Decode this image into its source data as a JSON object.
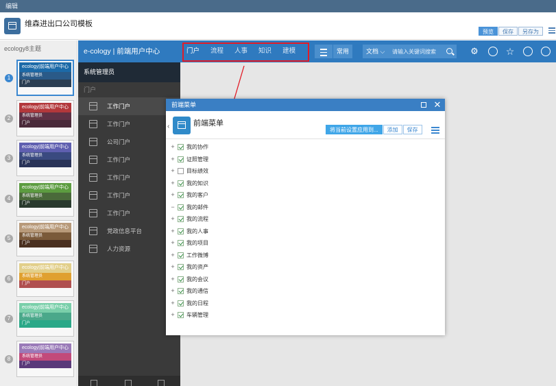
{
  "window": {
    "title": "编辑"
  },
  "header": {
    "title": "维森进出口公司模板",
    "actions": [
      "预览",
      "保存",
      "另存为"
    ],
    "list_icon": "list-icon"
  },
  "themes": {
    "title": "ecology8主题",
    "items": [
      {
        "num": "1",
        "brand": "ecology|前端用户中心",
        "user": "系统管理员",
        "section": "门户",
        "colors": [
          "#1c6aa8",
          "#2a5a88",
          "#2b3e52"
        ]
      },
      {
        "num": "2",
        "brand": "ecology|前端用户中心",
        "user": "系统管理员",
        "section": "门户",
        "colors": [
          "#b3383b",
          "#5f3145",
          "#4a2a3a"
        ]
      },
      {
        "num": "3",
        "brand": "ecology|前端用户中心",
        "user": "系统管理员",
        "section": "门户",
        "colors": [
          "#5f5fb0",
          "#3a4a80",
          "#2a3458"
        ]
      },
      {
        "num": "4",
        "brand": "ecology|前端用户中心",
        "user": "系统管理员",
        "section": "门户",
        "colors": [
          "#5c9c40",
          "#4a6a3a",
          "#2a3a2e"
        ]
      },
      {
        "num": "5",
        "brand": "ecology|前端用户中心",
        "user": "系统管理员",
        "section": "门户",
        "colors": [
          "#b89a7a",
          "#7a5a3a",
          "#4a3020"
        ]
      },
      {
        "num": "6",
        "brand": "ecology|前端用户中心",
        "user": "系统管理员",
        "section": "门户",
        "colors": [
          "#e2cf8a",
          "#e0a030",
          "#b05050"
        ]
      },
      {
        "num": "7",
        "brand": "ecology|前端用户中心",
        "user": "系统管理员",
        "section": "门户",
        "colors": [
          "#7acfaa",
          "#4aa88a",
          "#2aa888"
        ]
      },
      {
        "num": "8",
        "brand": "ecology|前端用户中心",
        "user": "系统管理员",
        "section": "门户",
        "colors": [
          "#9a7ab8",
          "#c24a7a",
          "#5a3a7a"
        ]
      }
    ]
  },
  "app": {
    "brand": "e-cology | 前端用户中心",
    "nav": [
      "门户",
      "流程",
      "人事",
      "知识",
      "建模"
    ],
    "common": "常用",
    "search": {
      "category": "文档",
      "placeholder": "请输入关键词搜索"
    },
    "right_icons": [
      "settings-icon",
      "palette-icon",
      "star-icon",
      "more-icon",
      "power-icon"
    ]
  },
  "sidebar": {
    "user": "系统管理员",
    "section": "门户",
    "items": [
      "工作门户",
      "工作门户",
      "公司门户",
      "工作门户",
      "工作门户",
      "工作门户",
      "工作门户",
      "党政信息平台",
      "人力资源"
    ]
  },
  "dialog": {
    "titlebar": "前端菜单",
    "title": "前端菜单",
    "actions": [
      "将当前设置应用到...",
      "添加",
      "保存"
    ],
    "tree": [
      {
        "label": "我的协作",
        "toggle": "+",
        "checked": true
      },
      {
        "label": "证照管理",
        "toggle": "+",
        "checked": true
      },
      {
        "label": "目标绩效",
        "toggle": "+",
        "checked": false
      },
      {
        "label": "我的知识",
        "toggle": "+",
        "checked": true
      },
      {
        "label": "我的客户",
        "toggle": "+",
        "checked": true
      },
      {
        "label": "我的邮件",
        "toggle": "−",
        "checked": true
      },
      {
        "label": "我的流程",
        "toggle": "+",
        "checked": true
      },
      {
        "label": "我的人事",
        "toggle": "+",
        "checked": true
      },
      {
        "label": "我的项目",
        "toggle": "+",
        "checked": true
      },
      {
        "label": "工作微博",
        "toggle": "+",
        "checked": true
      },
      {
        "label": "我的资产",
        "toggle": "+",
        "checked": true
      },
      {
        "label": "我的会议",
        "toggle": "+",
        "checked": true
      },
      {
        "label": "我的通信",
        "toggle": "+",
        "checked": true
      },
      {
        "label": "我的日程",
        "toggle": "+",
        "checked": true
      },
      {
        "label": "车辆管理",
        "toggle": "+",
        "checked": true
      }
    ]
  },
  "colors": {
    "accent": "#2f7abf",
    "highlight": "#e21c27",
    "sidebar": "#3a3a3a"
  }
}
